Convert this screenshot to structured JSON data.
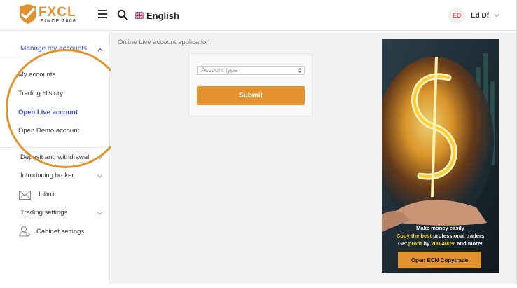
{
  "header": {
    "logo": {
      "brand": "FXCL",
      "tagline": "SINCE 2006"
    },
    "language": {
      "label": "English",
      "flag": "uk-flag-icon"
    },
    "user": {
      "initials": "ED",
      "name": "Ed Df"
    }
  },
  "sidebar": {
    "section_title": "Manage my accounts",
    "sub_items": [
      {
        "label": "My accounts",
        "active": false
      },
      {
        "label": "Trading History",
        "active": false
      },
      {
        "label": "Open Live account",
        "active": true
      },
      {
        "label": "Open Demo account",
        "active": false
      }
    ],
    "items": [
      {
        "label": "Deposit and withdrawal",
        "has_chevron": true,
        "icon": null
      },
      {
        "label": "Introducing broker",
        "has_chevron": true,
        "icon": null
      },
      {
        "label": "Inbox",
        "has_chevron": false,
        "icon": "mail-icon"
      },
      {
        "label": "Trading settings",
        "has_chevron": true,
        "icon": null
      },
      {
        "label": "Cabinet settings",
        "has_chevron": false,
        "icon": "user-settings-icon"
      }
    ]
  },
  "main": {
    "page_title": "Online Live account application",
    "form": {
      "account_type_placeholder": "Account type",
      "submit_label": "Submit"
    },
    "banner": {
      "line1": "Make money easily",
      "line2_a": "Copy the best",
      "line2_b": "professional traders",
      "line3_a": "Get",
      "line3_b": "profit",
      "line3_c": "by",
      "line3_d": "200-400%",
      "line3_e": "and more!",
      "button_label": "Open ECN Copytrade"
    }
  },
  "colors": {
    "accent": "#e3922d",
    "link_active": "#3a50d6",
    "highlight_ring": "#e0952f",
    "avatar_text": "#e04040"
  }
}
